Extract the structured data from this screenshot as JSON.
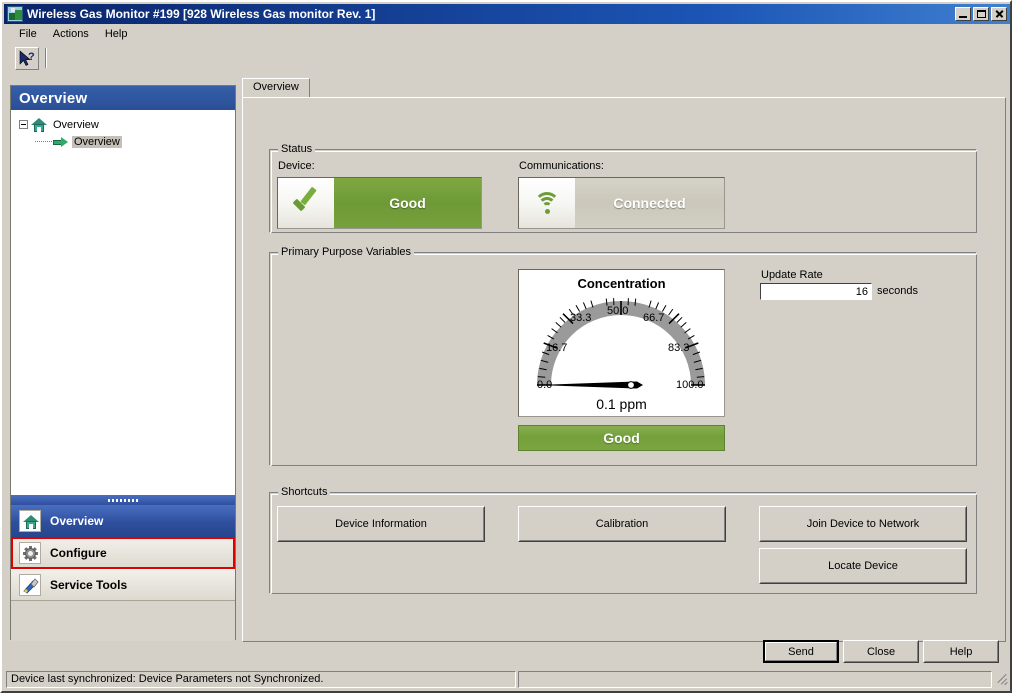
{
  "window": {
    "title": "Wireless Gas Monitor #199 [928 Wireless Gas monitor Rev. 1]",
    "icon": "device-antenna-icon",
    "minimize": "_",
    "maximize": "□",
    "close": "✕"
  },
  "menubar": {
    "items": [
      {
        "label": "File"
      },
      {
        "label": "Actions"
      },
      {
        "label": "Help"
      }
    ]
  },
  "toolbar": {
    "whats_this_icon": "arrow-question-icon"
  },
  "explorer": {
    "header": "Overview",
    "tree": [
      {
        "label": "Overview",
        "icon": "home-icon",
        "selected": false
      },
      {
        "label": "Overview",
        "icon": "green-arrow-icon",
        "selected": true
      }
    ]
  },
  "nav": {
    "items": [
      {
        "label": "Overview",
        "icon": "home-icon",
        "state": "active"
      },
      {
        "label": "Configure",
        "icon": "gear-icon",
        "state": "highlighted"
      },
      {
        "label": "Service Tools",
        "icon": "tools-icon",
        "state": "normal"
      }
    ],
    "highlight_color": "#e00000"
  },
  "tabs": [
    {
      "label": "Overview",
      "selected": true
    }
  ],
  "status_group": {
    "title": "Status",
    "device": {
      "label": "Device:",
      "icon": "green-check-icon",
      "value": "Good",
      "color": "#74a03a"
    },
    "communications": {
      "label": "Communications:",
      "icon": "wifi-icon",
      "value": "Connected",
      "color": "#cbc7bb"
    }
  },
  "ppv_group": {
    "title": "Primary Purpose Variables",
    "status_bar": {
      "label": "Good",
      "color": "#74a03a"
    },
    "update_rate": {
      "label": "Update Rate",
      "value": "16",
      "units": "seconds"
    }
  },
  "shortcuts_group": {
    "title": "Shortcuts",
    "buttons": [
      {
        "label": "Device Information"
      },
      {
        "label": "Calibration"
      },
      {
        "label": "Join Device to Network"
      },
      {
        "label": "Locate Device"
      }
    ]
  },
  "footer": {
    "buttons": [
      {
        "label": "Send",
        "default": true
      },
      {
        "label": "Close",
        "default": false
      },
      {
        "label": "Help",
        "default": false
      }
    ]
  },
  "statusbar": {
    "message": "Device last synchronized: Device Parameters not Synchronized."
  },
  "chart_data": {
    "type": "gauge",
    "title": "Concentration",
    "value": 0.1,
    "value_label": "0.1 ppm",
    "units": "ppm",
    "min": 0.0,
    "max": 100.0,
    "tick_labels": [
      "0.0",
      "16.7",
      "33.3",
      "50.0",
      "66.7",
      "83.3",
      "100.0"
    ],
    "tick_values": [
      0.0,
      16.7,
      33.3,
      50.0,
      66.7,
      83.3,
      100.0
    ],
    "major_ticks": 7,
    "minor_ticks_per_major": 5,
    "start_angle_deg": 180,
    "sweep_deg": 180,
    "band_color": "#999999",
    "needle_color": "#000000",
    "background": "#ffffff"
  }
}
